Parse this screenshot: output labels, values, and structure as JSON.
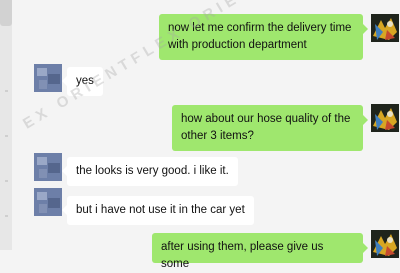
{
  "messages": [
    {
      "sender": "me",
      "text": "now let me confirm the delivery time with production department"
    },
    {
      "sender": "contact",
      "text": "yes"
    },
    {
      "sender": "me",
      "text": "how about our hose quality of the other 3 items?"
    },
    {
      "sender": "contact",
      "text": "the looks is very good. i like it."
    },
    {
      "sender": "contact",
      "text": "but i have not use it in the car yet"
    },
    {
      "sender": "me",
      "text": "after using them, please give us some"
    }
  ],
  "watermark": "EX ORIENTFLEX ORIENTFLEX OR",
  "colors": {
    "background": "#f4f4f4",
    "outgoing_bubble": "#9fe76e",
    "incoming_bubble": "#ffffff"
  }
}
